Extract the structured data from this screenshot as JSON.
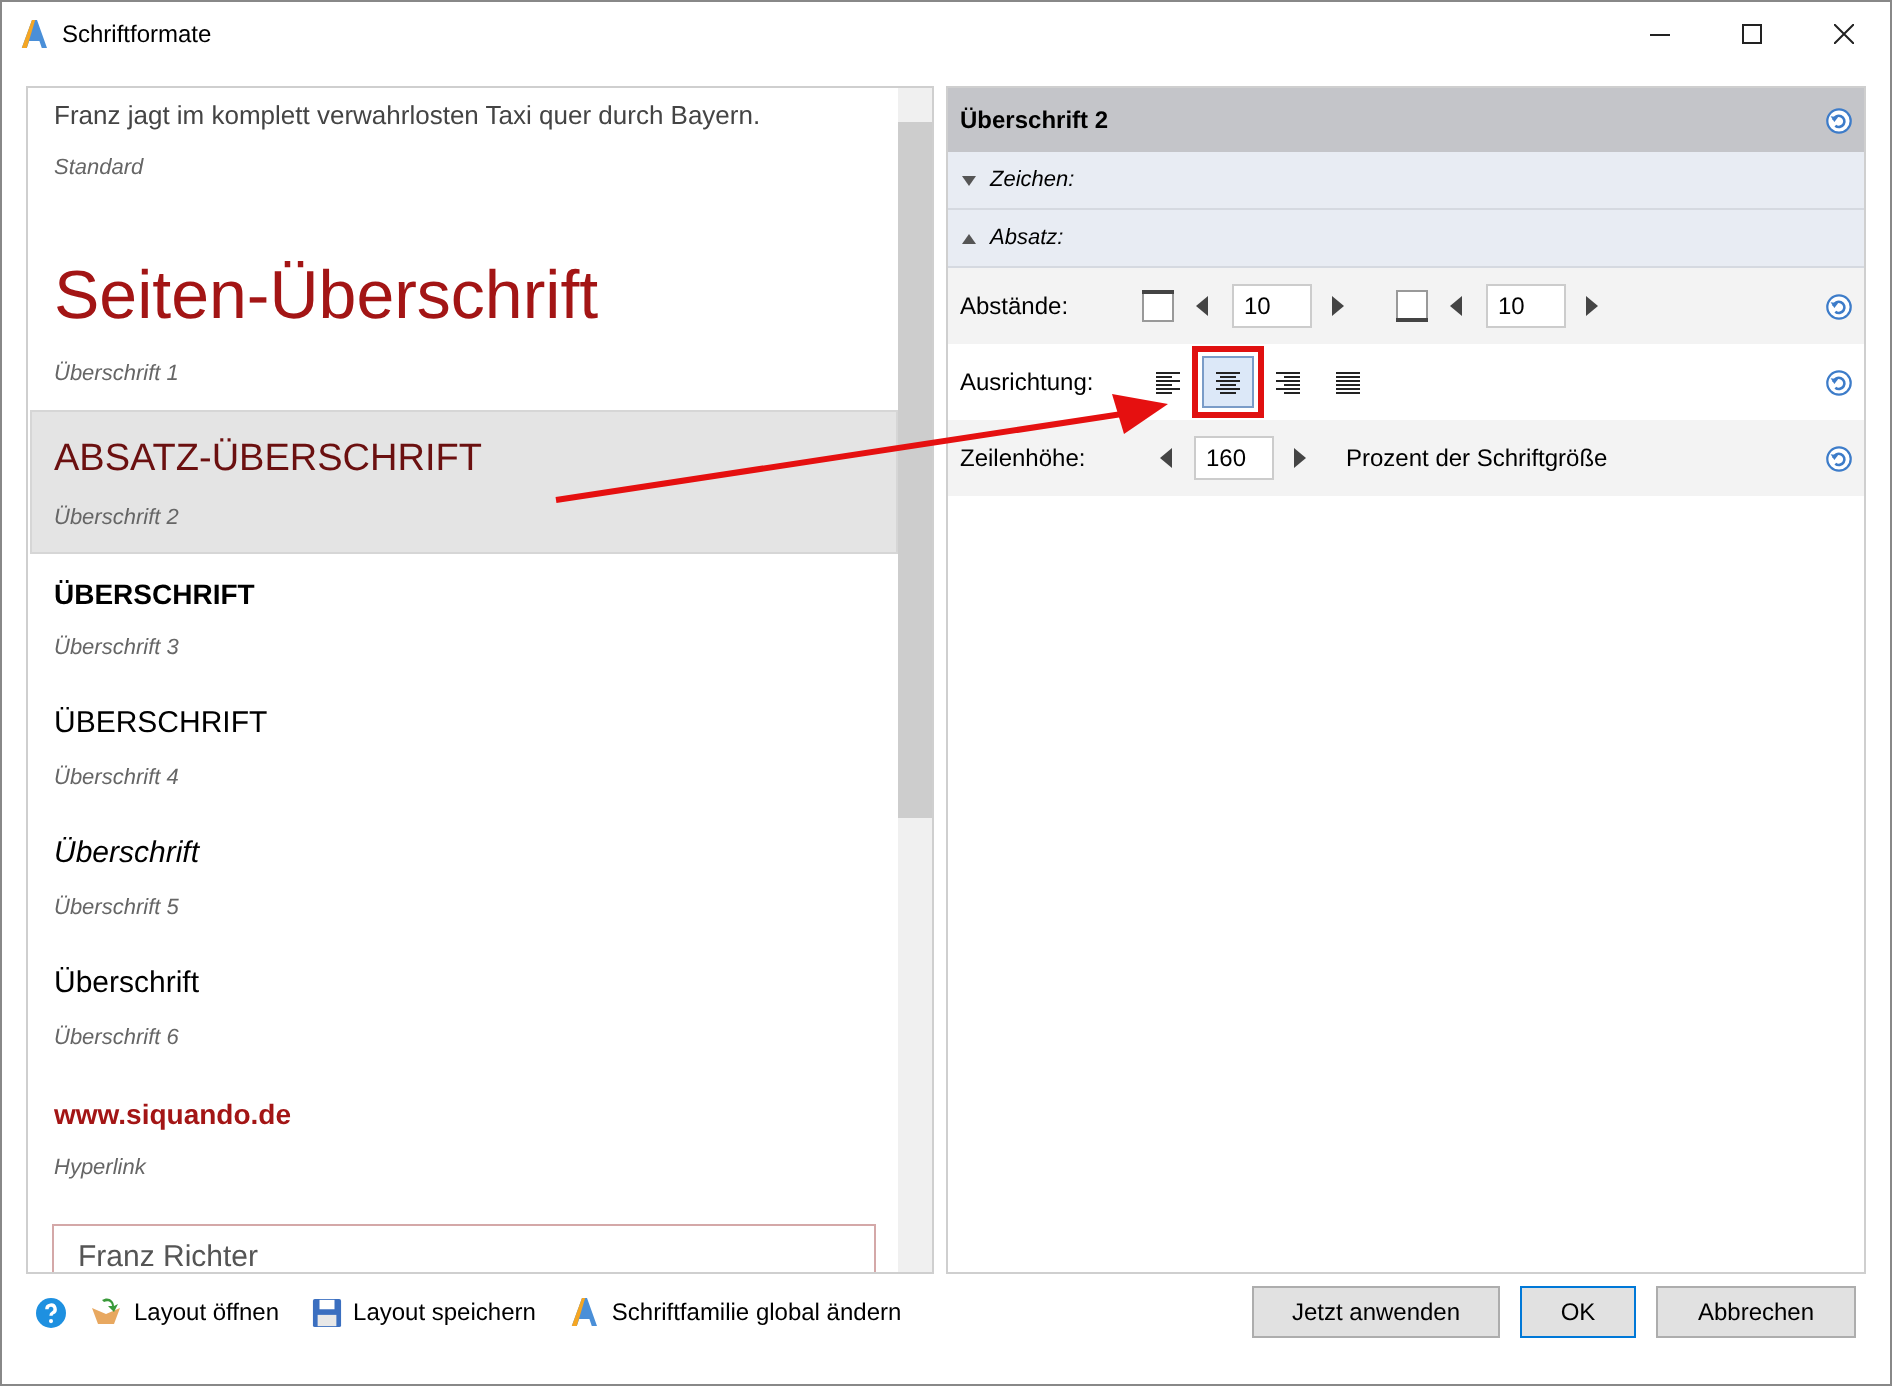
{
  "window": {
    "title": "Schriftformate"
  },
  "styles": [
    {
      "kind": "standard",
      "sample": "Franz jagt im komplett verwahrlosten Taxi quer durch Bayern.",
      "name": "Standard",
      "selected": false
    },
    {
      "kind": "h1",
      "sample": "Seiten-Überschrift",
      "name": "Überschrift 1",
      "selected": false
    },
    {
      "kind": "h2",
      "sample": "ABSATZ-ÜBERSCHRIFT",
      "name": "Überschrift 2",
      "selected": true
    },
    {
      "kind": "h3",
      "sample": "ÜBERSCHRIFT",
      "name": "Überschrift 3",
      "selected": false
    },
    {
      "kind": "h4",
      "sample": "ÜBERSCHRIFT",
      "name": "Überschrift 4",
      "selected": false
    },
    {
      "kind": "h5",
      "sample": "Überschrift",
      "name": "Überschrift 5",
      "selected": false
    },
    {
      "kind": "h6",
      "sample": "Überschrift",
      "name": "Überschrift 6",
      "selected": false
    },
    {
      "kind": "hyperlink",
      "sample": "www.siquando.de",
      "name": "Hyperlink",
      "selected": false
    },
    {
      "kind": "boxed",
      "sample": "Franz Richter",
      "selected": false
    }
  ],
  "editor": {
    "title": "Überschrift 2",
    "sections": [
      {
        "label": "Zeichen:",
        "expanded": false
      },
      {
        "label": "Absatz:",
        "expanded": true
      }
    ],
    "spacing": {
      "label": "Abstände:",
      "above": "10",
      "below": "10"
    },
    "alignment": {
      "label": "Ausrichtung:",
      "options": [
        {
          "kind": "left",
          "selected": false
        },
        {
          "kind": "center",
          "selected": true
        },
        {
          "kind": "right",
          "selected": false
        },
        {
          "kind": "justify",
          "selected": false
        }
      ]
    },
    "line_height": {
      "label": "Zeilenhöhe:",
      "value": "160",
      "unit": "Prozent der Schriftgröße"
    }
  },
  "footer": {
    "links": [
      {
        "kind": "open",
        "label": "Layout öffnen"
      },
      {
        "kind": "save",
        "label": "Layout speichern"
      },
      {
        "kind": "font",
        "label": "Schriftfamilie global ändern"
      }
    ],
    "buttons": [
      {
        "label": "Jetzt anwenden",
        "default": false
      },
      {
        "label": "OK",
        "default": true
      },
      {
        "label": "Abbrechen",
        "default": false
      }
    ]
  }
}
